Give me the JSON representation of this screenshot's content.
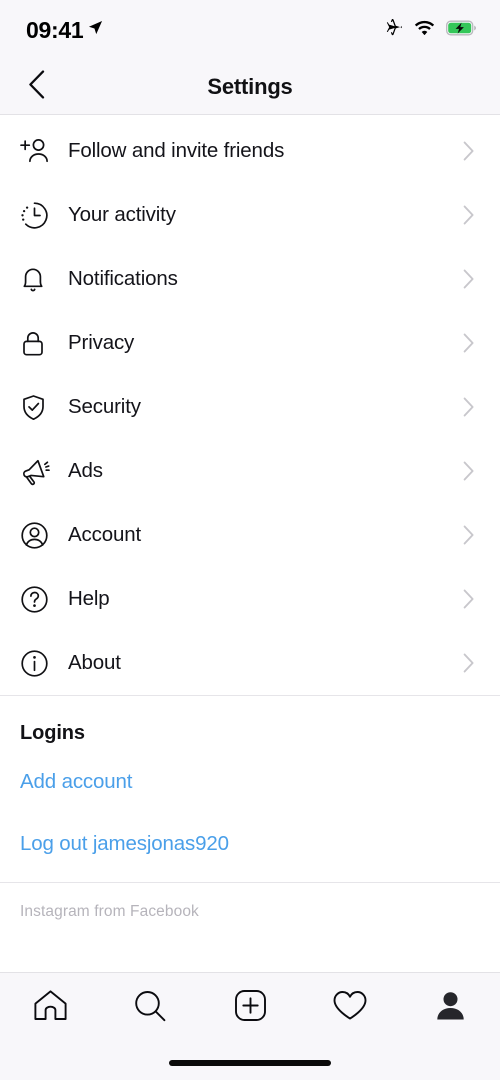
{
  "status_bar": {
    "time": "09:41",
    "icons": [
      "location-arrow-icon",
      "airplane-mode-icon",
      "wifi-icon",
      "battery-charging-icon"
    ],
    "battery_color": "#34c759",
    "charging": true
  },
  "header": {
    "title": "Settings",
    "back_icon": "chevron-left-icon"
  },
  "settings_items": [
    {
      "label": "Follow and invite friends",
      "icon": "add-person-icon"
    },
    {
      "label": "Your activity",
      "icon": "activity-clock-icon"
    },
    {
      "label": "Notifications",
      "icon": "bell-icon"
    },
    {
      "label": "Privacy",
      "icon": "lock-icon"
    },
    {
      "label": "Security",
      "icon": "shield-check-icon"
    },
    {
      "label": "Ads",
      "icon": "megaphone-icon"
    },
    {
      "label": "Account",
      "icon": "person-circle-icon"
    },
    {
      "label": "Help",
      "icon": "question-circle-icon"
    },
    {
      "label": "About",
      "icon": "info-circle-icon"
    }
  ],
  "logins": {
    "title": "Logins",
    "add_account": "Add account",
    "log_out": "Log out jamesjonas920",
    "username": "jamesjonas920",
    "link_color": "#4a9fe9"
  },
  "footer": {
    "attribution": "Instagram from Facebook"
  },
  "tabbar": {
    "items": [
      {
        "name": "home-icon",
        "active": false
      },
      {
        "name": "search-icon",
        "active": false
      },
      {
        "name": "add-post-icon",
        "active": false
      },
      {
        "name": "heart-icon",
        "active": false
      },
      {
        "name": "profile-icon",
        "active": true
      }
    ]
  }
}
